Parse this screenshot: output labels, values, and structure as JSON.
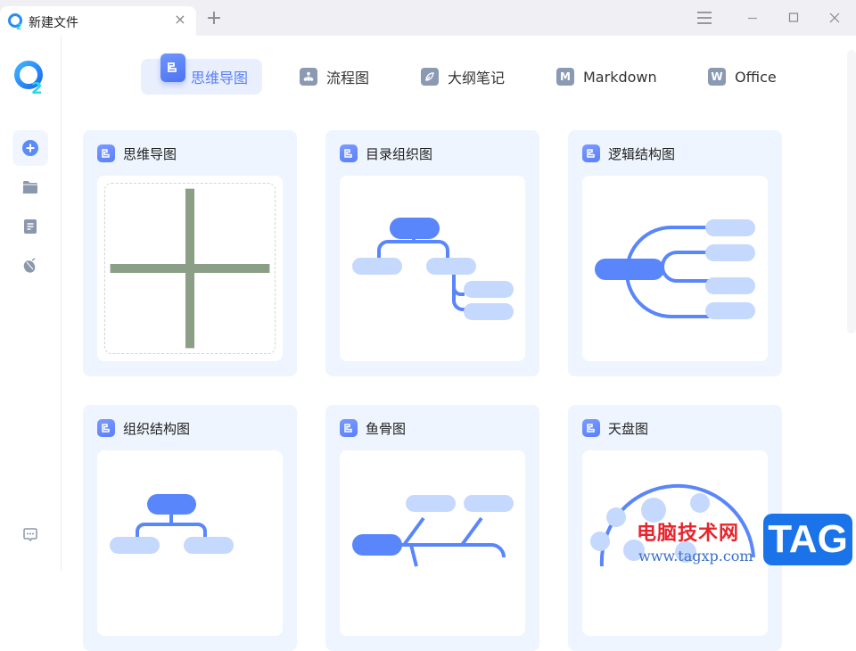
{
  "titlebar": {
    "tab_title": "新建文件",
    "close_tab": "×",
    "new_tab": "+"
  },
  "type_tabs": [
    {
      "label": "思维导图",
      "icon": "mindmap-icon",
      "active": true
    },
    {
      "label": "流程图",
      "icon": "flowchart-icon",
      "active": false
    },
    {
      "label": "大纲笔记",
      "icon": "outline-icon",
      "active": false
    },
    {
      "label": "Markdown",
      "icon": "markdown-icon",
      "icon_letter": "M",
      "active": false
    },
    {
      "label": "Office",
      "icon": "office-icon",
      "icon_letter": "W",
      "active": false
    }
  ],
  "sidebar": {
    "items": [
      {
        "name": "new",
        "icon": "plus-circle-icon",
        "active": true
      },
      {
        "name": "folder",
        "icon": "folder-icon",
        "active": false
      },
      {
        "name": "document",
        "icon": "document-icon",
        "active": false
      },
      {
        "name": "acorn",
        "icon": "acorn-icon",
        "active": false
      }
    ],
    "feedback_icon": "chat-bubble-icon"
  },
  "templates": [
    {
      "title": "思维导图",
      "preview": "blank"
    },
    {
      "title": "目录组织图",
      "preview": "directory"
    },
    {
      "title": "逻辑结构图",
      "preview": "logic"
    },
    {
      "title": "组织结构图",
      "preview": "org"
    },
    {
      "title": "鱼骨图",
      "preview": "fishbone"
    },
    {
      "title": "天盘图",
      "preview": "radial"
    }
  ],
  "colors": {
    "accent": "#5a7ff9",
    "node_light": "#c5d8fd",
    "card_bg": "#eef5fe"
  },
  "watermark": {
    "cn": "电脑技术网",
    "url": "www.tagxp.com",
    "tag": "TAG"
  }
}
